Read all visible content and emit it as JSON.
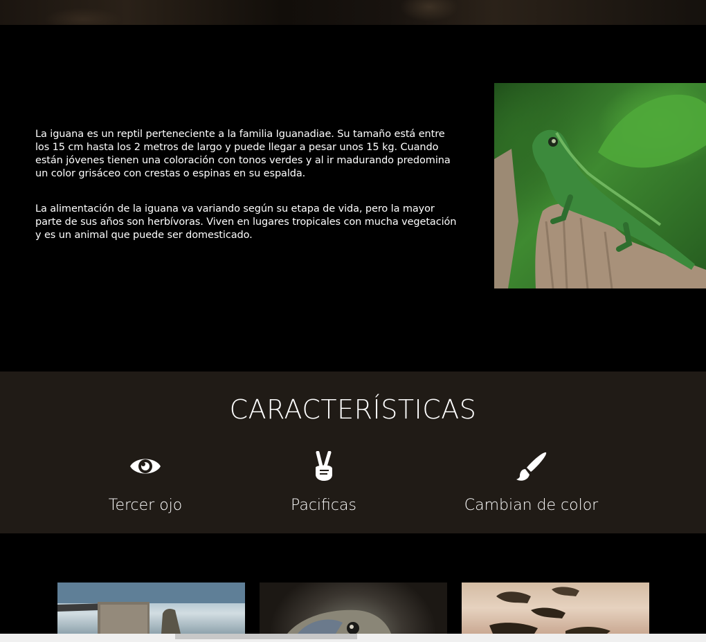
{
  "intro": {
    "paragraph_1": "La iguana es un reptil perteneciente a la familia Iguanadiae. Su tamaño está entre los 15 cm hasta los 2 metros de largo y puede llegar a pesar unos 15 kg. Cuando están jóvenes tienen una coloración con tonos verdes y al ir madurando predomina un color grisáceo con crestas o espinas en su espalda.",
    "paragraph_2": "La alimentación de la iguana va variando según su etapa de vida, pero la mayor parte de sus años son herbívoras. Viven en lugares tropicales con mucha vegetación y es un animal que puede ser domesticado."
  },
  "features": {
    "title": "CARACTERÍSTICAS",
    "items": [
      {
        "label": "Tercer ojo",
        "icon": "eye-icon"
      },
      {
        "label": "Pacificas",
        "icon": "peace-hand-icon"
      },
      {
        "label": "Cambian de color",
        "icon": "paint-brush-icon"
      }
    ]
  },
  "colors": {
    "page_bg": "#000000",
    "features_bg": "#201b16",
    "text": "#ffffff"
  }
}
